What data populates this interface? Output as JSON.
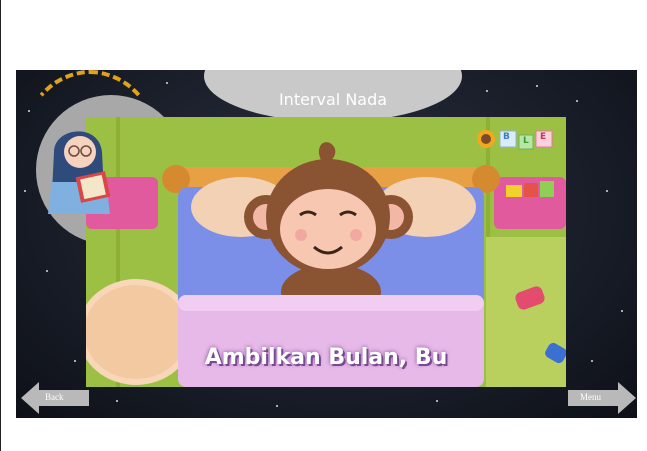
{
  "header": {
    "title": "Interval Nada"
  },
  "video": {
    "caption": "Ambilkan Bulan, Bu",
    "logo_letters": [
      "B",
      "L",
      "E"
    ]
  },
  "nav": {
    "back_label": "Back",
    "menu_label": "Menu"
  },
  "colors": {
    "stage_bg": "#161a24",
    "scene_green": "#9cc043",
    "blanket_pink": "#e6b9e8",
    "bed_blue": "#7b8fe8",
    "monkey_brown": "#8a5332",
    "accent_yellow": "#e0a21b"
  },
  "icons": {
    "avatar": "girl-reading-icon",
    "back": "arrow-left-icon",
    "menu": "arrow-right-icon"
  }
}
